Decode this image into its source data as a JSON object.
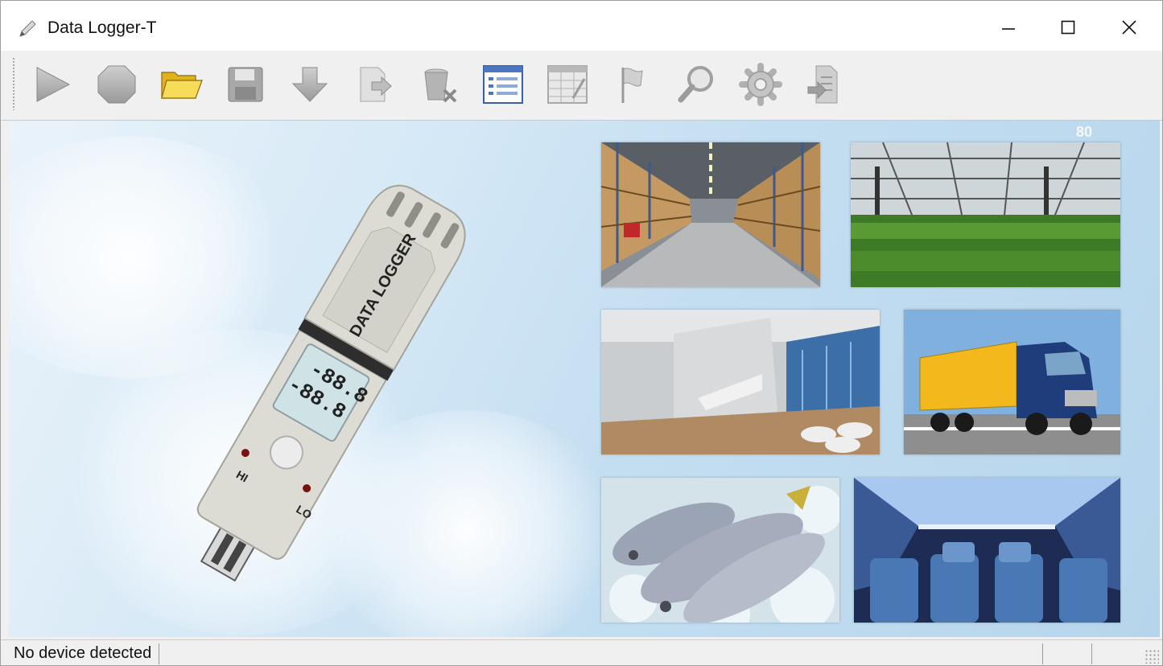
{
  "window": {
    "title": "Data Logger-T"
  },
  "toolbar": {
    "buttons": [
      {
        "name": "play-button",
        "icon": "play-icon",
        "enabled": false
      },
      {
        "name": "stop-button",
        "icon": "stop-icon",
        "enabled": false
      },
      {
        "name": "open-button",
        "icon": "folder-open-icon",
        "enabled": true
      },
      {
        "name": "save-button",
        "icon": "save-icon",
        "enabled": false
      },
      {
        "name": "download-button",
        "icon": "download-arrow-icon",
        "enabled": false
      },
      {
        "name": "export-button",
        "icon": "export-file-icon",
        "enabled": false
      },
      {
        "name": "delete-button",
        "icon": "trash-icon",
        "enabled": false
      },
      {
        "name": "list-view-button",
        "icon": "list-view-icon",
        "enabled": true
      },
      {
        "name": "table-view-button",
        "icon": "table-icon",
        "enabled": false
      },
      {
        "name": "flag-button",
        "icon": "flag-icon",
        "enabled": false
      },
      {
        "name": "search-button",
        "icon": "magnifier-icon",
        "enabled": false
      },
      {
        "name": "settings-button",
        "icon": "gear-icon",
        "enabled": false
      },
      {
        "name": "report-button",
        "icon": "report-import-icon",
        "enabled": false
      }
    ]
  },
  "main": {
    "device_label": "DATA LOGGER",
    "lcd_top": "-88.8",
    "lcd_bottom": "-88.8",
    "led_hi": "HI",
    "led_lo": "LO",
    "corner_number": "80",
    "photos": [
      "warehouse-photo",
      "greenhouse-photo",
      "interior-lobby-photo",
      "truck-photo",
      "frozen-fish-photo",
      "aircraft-cabin-photo"
    ]
  },
  "status": {
    "text": "No device detected"
  },
  "colors": {
    "accent_blue": "#3a5fa8",
    "folder_yellow": "#f0c828",
    "disabled_gray": "#a8a8a8"
  }
}
